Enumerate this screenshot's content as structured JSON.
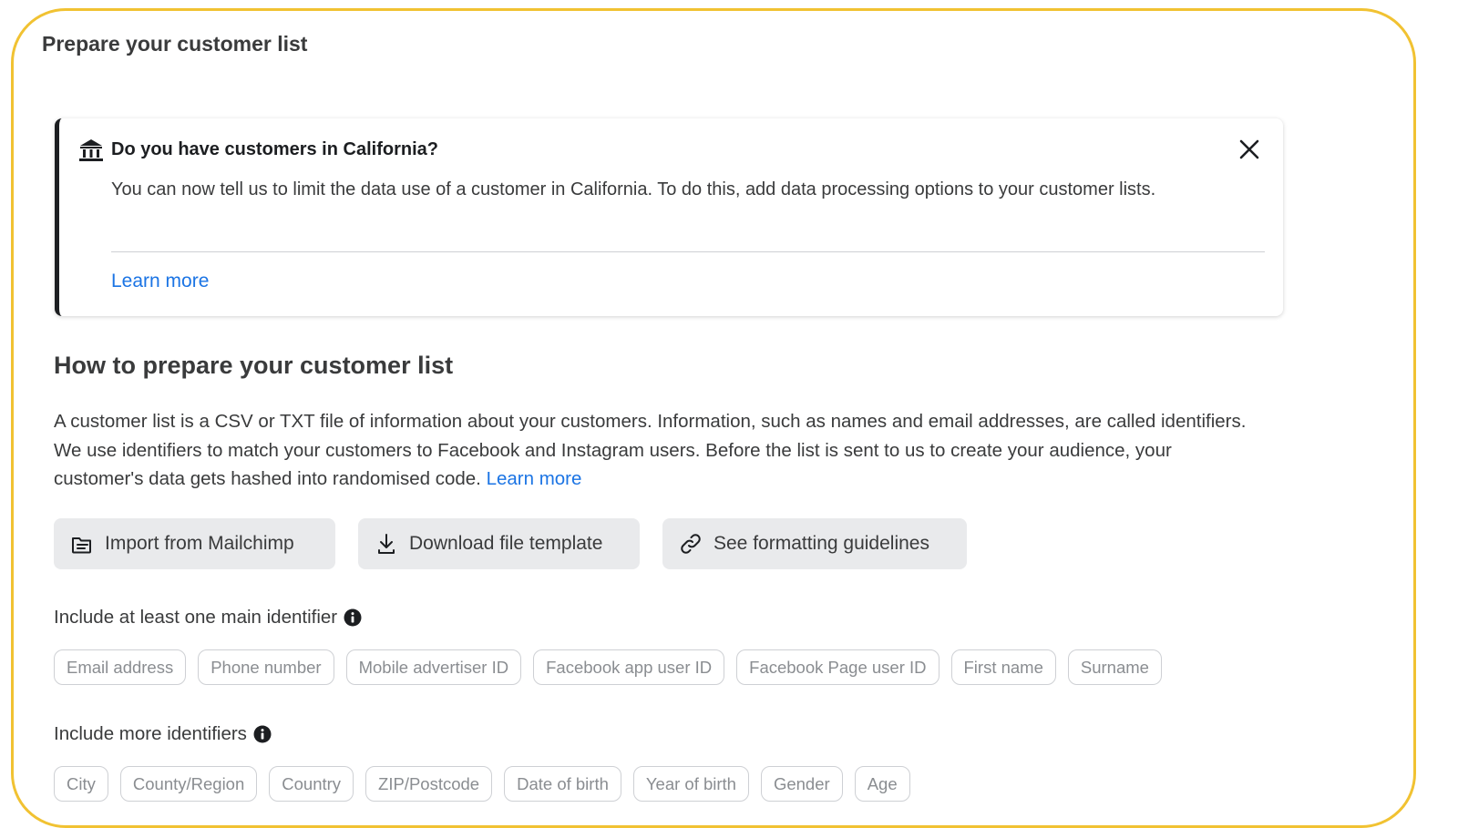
{
  "page_title": "Prepare your customer list",
  "banner": {
    "icon": "bank-building-icon",
    "title": "Do you have customers in California?",
    "body": "You can now tell us to limit the data use of a customer in California. To do this, add data processing options to your customer lists.",
    "link": "Learn more",
    "close_icon": "close-icon"
  },
  "section": {
    "heading": "How to prepare your customer list",
    "body": "A customer list is a CSV or TXT file of information about your customers. Information, such as names and email addresses, are called identifiers. We use identifiers to match your customers to Facebook and Instagram users. Before the list is sent to us to create your audience, your customer's data gets hashed into randomised code.",
    "link": "Learn more"
  },
  "buttons": {
    "import": {
      "label": "Import from Mailchimp",
      "icon": "folder-icon"
    },
    "download": {
      "label": "Download file template",
      "icon": "download-icon"
    },
    "guidelines": {
      "label": "See formatting guidelines",
      "icon": "link-icon"
    }
  },
  "main_identifiers": {
    "label": "Include at least one main identifier",
    "items": [
      "Email address",
      "Phone number",
      "Mobile advertiser ID",
      "Facebook app user ID",
      "Facebook Page user ID",
      "First name",
      "Surname"
    ]
  },
  "more_identifiers": {
    "label": "Include more identifiers",
    "items": [
      "City",
      "County/Region",
      "Country",
      "ZIP/Postcode",
      "Date of birth",
      "Year of birth",
      "Gender",
      "Age"
    ]
  },
  "colors": {
    "frame_border": "#f1c232",
    "link": "#1b74e4",
    "button_bg": "#e9eaec"
  }
}
